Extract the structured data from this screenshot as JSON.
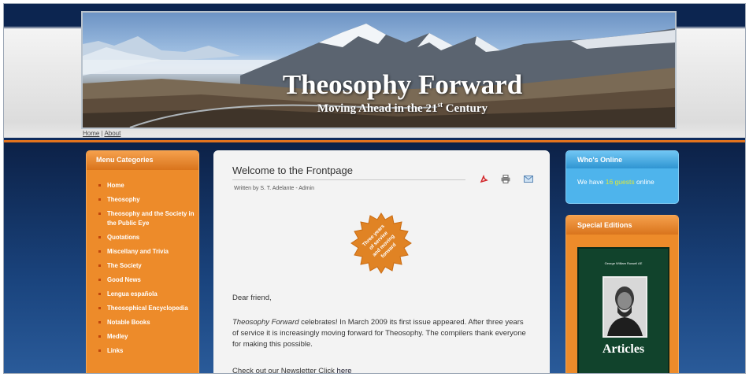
{
  "header": {
    "title": "Theosophy Forward",
    "subtitle_pre": "Moving Ahead in the 21",
    "subtitle_sup": "st",
    "subtitle_post": " Century"
  },
  "topnav": {
    "home": "Home",
    "separator": "|",
    "about": "About"
  },
  "menu": {
    "heading": "Menu Categories",
    "items": [
      "Home",
      "Theosophy",
      "Theosophy and the Society in the Public Eye",
      "Quotations",
      "Miscellany and Trivia",
      "The Society",
      "Good News",
      "Lengua española",
      "Theosophical Encyclopedia",
      "Notable Books",
      "Medley",
      "Links"
    ]
  },
  "article": {
    "title": "Welcome to the Frontpage",
    "written_by": "Written by S. T. Adelante - Admin",
    "icons": [
      "pdf-icon",
      "print-icon",
      "email-icon"
    ],
    "badge_text": "Three years of service and moving forward",
    "greeting": "Dear friend,",
    "para1_italic": "Theosophy  Forward",
    "para1_rest": " celebrates! In March 2009 its first issue appeared. After three years of service it is increasingly moving forward for Theosophy. The compilers thank everyone for making this possible.",
    "newsletter_text": "Check out our Newsletter Click ",
    "newsletter_link": "here"
  },
  "whos_online": {
    "heading": "Who's Online",
    "pre": "We have ",
    "guests": "16 guests",
    "post": " online"
  },
  "special": {
    "heading": "Special Editions",
    "book_author": "George William Russell AE",
    "book_title": "Articles"
  },
  "colors": {
    "navy": "#0d2a5c",
    "orange": "#ed8b2a",
    "blue_box": "#4eb4ec",
    "book_green": "#11432c"
  }
}
